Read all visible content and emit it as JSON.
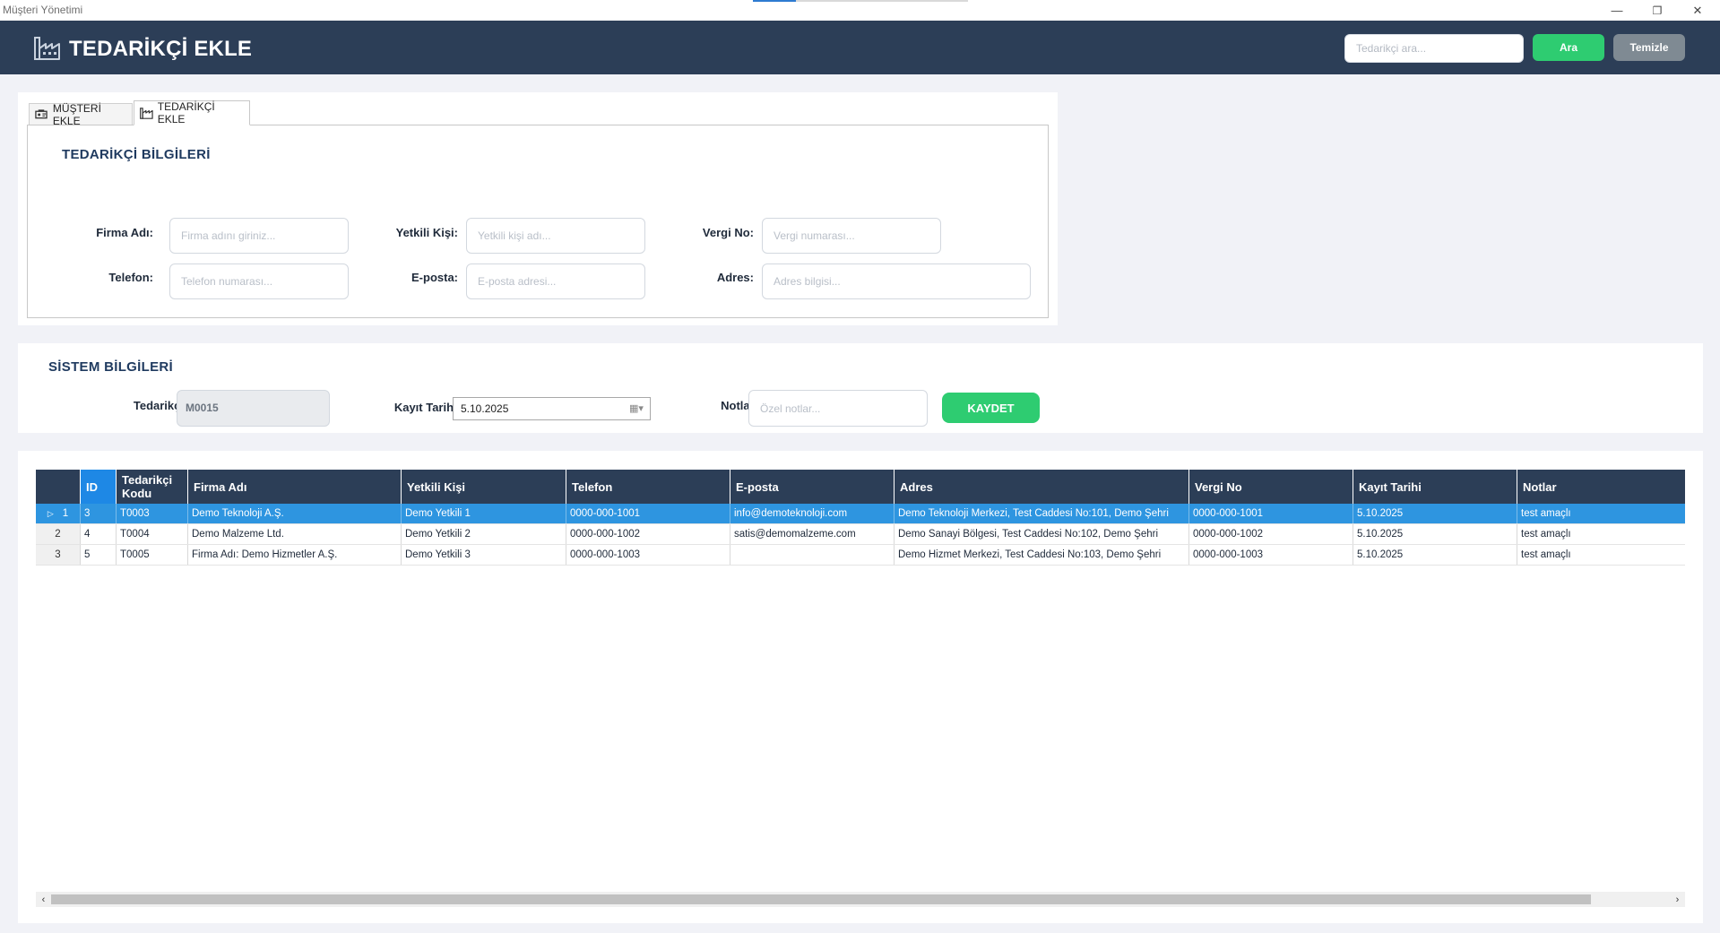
{
  "window": {
    "title": "Müşteri Yönetimi",
    "controls": {
      "minimize": "—",
      "restore": "❐",
      "close": "✕"
    }
  },
  "header": {
    "title": "TEDARİKÇİ EKLE",
    "search_placeholder": "Tedarikçi ara...",
    "search_button": "Ara",
    "clear_button": "Temizle",
    "bg_color": "#2c3e57",
    "accent_green": "#2ecc71"
  },
  "tabs": [
    {
      "label": "MÜŞTERİ EKLE",
      "icon": "customer-icon",
      "active": false
    },
    {
      "label": "TEDARİKÇİ EKLE",
      "icon": "factory-icon",
      "active": true
    }
  ],
  "supplier_info": {
    "title": "TEDARİKÇİ BİLGİLERİ",
    "fields": {
      "firma": {
        "label": "Firma Adı:",
        "placeholder": "Firma adını giriniz...",
        "value": ""
      },
      "yetkili": {
        "label": "Yetkili Kişi:",
        "placeholder": "Yetkili kişi adı...",
        "value": ""
      },
      "vergi": {
        "label": "Vergi No:",
        "placeholder": "Vergi numarası...",
        "value": ""
      },
      "telefon": {
        "label": "Telefon:",
        "placeholder": "Telefon numarası...",
        "value": ""
      },
      "eposta": {
        "label": "E-posta:",
        "placeholder": "E-posta adresi...",
        "value": ""
      },
      "adres": {
        "label": "Adres:",
        "placeholder": "Adres bilgisi...",
        "value": ""
      }
    }
  },
  "system_info": {
    "title": "SİSTEM BİLGİLERİ",
    "supplier_label": "Tedarikçi",
    "supplier_code": "M0015",
    "date_label": "Kayıt Tarihi:",
    "date_value": "5.10.2025",
    "notes_label": "Notlar:",
    "notes_placeholder": "Özel notlar...",
    "save_button": "KAYDET"
  },
  "grid": {
    "columns": [
      "ID",
      "Tedarikçi Kodu",
      "Firma Adı",
      "Yetkili Kişi",
      "Telefon",
      "E-posta",
      "Adres",
      "Vergi No",
      "Kayıt Tarihi",
      "Notlar"
    ],
    "rows": [
      {
        "row_no": "1",
        "id": "3",
        "kod": "T0003",
        "firma": "Demo Teknoloji A.Ş.",
        "yetkili": "Demo Yetkili 1",
        "telefon": "0000-000-1001",
        "eposta": "info@demoteknoloji.com",
        "adres": "Demo Teknoloji Merkezi, Test Caddesi No:101, Demo Şehri",
        "vergi": "0000-000-1001",
        "tarih": "5.10.2025",
        "notlar": "test amaçlı",
        "selected": true
      },
      {
        "row_no": "2",
        "id": "4",
        "kod": "T0004",
        "firma": "Demo Malzeme Ltd.",
        "yetkili": "Demo Yetkili 2",
        "telefon": "0000-000-1002",
        "eposta": "satis@demomalzeme.com",
        "adres": "Demo Sanayi Bölgesi, Test Caddesi No:102, Demo Şehri",
        "vergi": "0000-000-1002",
        "tarih": "5.10.2025",
        "notlar": "test amaçlı",
        "selected": false
      },
      {
        "row_no": "3",
        "id": "5",
        "kod": "T0005",
        "firma": "Firma Adı: Demo Hizmetler A.Ş.",
        "yetkili": "Demo Yetkili 3",
        "telefon": "0000-000-1003",
        "eposta": "",
        "adres": "Demo Hizmet Merkezi, Test Caddesi No:103, Demo Şehri",
        "vergi": "0000-000-1003",
        "tarih": "5.10.2025",
        "notlar": "test amaçlı",
        "selected": false
      }
    ],
    "selection_color": "#2e95e0"
  }
}
